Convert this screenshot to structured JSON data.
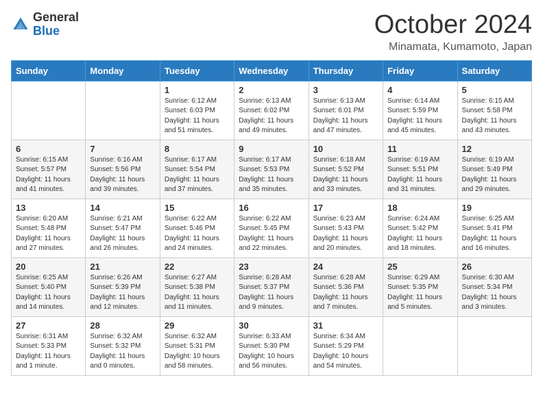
{
  "header": {
    "logo_general": "General",
    "logo_blue": "Blue",
    "title": "October 2024",
    "subtitle": "Minamata, Kumamoto, Japan"
  },
  "weekdays": [
    "Sunday",
    "Monday",
    "Tuesday",
    "Wednesday",
    "Thursday",
    "Friday",
    "Saturday"
  ],
  "weeks": [
    [
      {
        "day": "",
        "info": ""
      },
      {
        "day": "",
        "info": ""
      },
      {
        "day": "1",
        "info": "Sunrise: 6:12 AM\nSunset: 6:03 PM\nDaylight: 11 hours and 51 minutes."
      },
      {
        "day": "2",
        "info": "Sunrise: 6:13 AM\nSunset: 6:02 PM\nDaylight: 11 hours and 49 minutes."
      },
      {
        "day": "3",
        "info": "Sunrise: 6:13 AM\nSunset: 6:01 PM\nDaylight: 11 hours and 47 minutes."
      },
      {
        "day": "4",
        "info": "Sunrise: 6:14 AM\nSunset: 5:59 PM\nDaylight: 11 hours and 45 minutes."
      },
      {
        "day": "5",
        "info": "Sunrise: 6:15 AM\nSunset: 5:58 PM\nDaylight: 11 hours and 43 minutes."
      }
    ],
    [
      {
        "day": "6",
        "info": "Sunrise: 6:15 AM\nSunset: 5:57 PM\nDaylight: 11 hours and 41 minutes."
      },
      {
        "day": "7",
        "info": "Sunrise: 6:16 AM\nSunset: 5:56 PM\nDaylight: 11 hours and 39 minutes."
      },
      {
        "day": "8",
        "info": "Sunrise: 6:17 AM\nSunset: 5:54 PM\nDaylight: 11 hours and 37 minutes."
      },
      {
        "day": "9",
        "info": "Sunrise: 6:17 AM\nSunset: 5:53 PM\nDaylight: 11 hours and 35 minutes."
      },
      {
        "day": "10",
        "info": "Sunrise: 6:18 AM\nSunset: 5:52 PM\nDaylight: 11 hours and 33 minutes."
      },
      {
        "day": "11",
        "info": "Sunrise: 6:19 AM\nSunset: 5:51 PM\nDaylight: 11 hours and 31 minutes."
      },
      {
        "day": "12",
        "info": "Sunrise: 6:19 AM\nSunset: 5:49 PM\nDaylight: 11 hours and 29 minutes."
      }
    ],
    [
      {
        "day": "13",
        "info": "Sunrise: 6:20 AM\nSunset: 5:48 PM\nDaylight: 11 hours and 27 minutes."
      },
      {
        "day": "14",
        "info": "Sunrise: 6:21 AM\nSunset: 5:47 PM\nDaylight: 11 hours and 26 minutes."
      },
      {
        "day": "15",
        "info": "Sunrise: 6:22 AM\nSunset: 5:46 PM\nDaylight: 11 hours and 24 minutes."
      },
      {
        "day": "16",
        "info": "Sunrise: 6:22 AM\nSunset: 5:45 PM\nDaylight: 11 hours and 22 minutes."
      },
      {
        "day": "17",
        "info": "Sunrise: 6:23 AM\nSunset: 5:43 PM\nDaylight: 11 hours and 20 minutes."
      },
      {
        "day": "18",
        "info": "Sunrise: 6:24 AM\nSunset: 5:42 PM\nDaylight: 11 hours and 18 minutes."
      },
      {
        "day": "19",
        "info": "Sunrise: 6:25 AM\nSunset: 5:41 PM\nDaylight: 11 hours and 16 minutes."
      }
    ],
    [
      {
        "day": "20",
        "info": "Sunrise: 6:25 AM\nSunset: 5:40 PM\nDaylight: 11 hours and 14 minutes."
      },
      {
        "day": "21",
        "info": "Sunrise: 6:26 AM\nSunset: 5:39 PM\nDaylight: 11 hours and 12 minutes."
      },
      {
        "day": "22",
        "info": "Sunrise: 6:27 AM\nSunset: 5:38 PM\nDaylight: 11 hours and 11 minutes."
      },
      {
        "day": "23",
        "info": "Sunrise: 6:28 AM\nSunset: 5:37 PM\nDaylight: 11 hours and 9 minutes."
      },
      {
        "day": "24",
        "info": "Sunrise: 6:28 AM\nSunset: 5:36 PM\nDaylight: 11 hours and 7 minutes."
      },
      {
        "day": "25",
        "info": "Sunrise: 6:29 AM\nSunset: 5:35 PM\nDaylight: 11 hours and 5 minutes."
      },
      {
        "day": "26",
        "info": "Sunrise: 6:30 AM\nSunset: 5:34 PM\nDaylight: 11 hours and 3 minutes."
      }
    ],
    [
      {
        "day": "27",
        "info": "Sunrise: 6:31 AM\nSunset: 5:33 PM\nDaylight: 11 hours and 1 minute."
      },
      {
        "day": "28",
        "info": "Sunrise: 6:32 AM\nSunset: 5:32 PM\nDaylight: 11 hours and 0 minutes."
      },
      {
        "day": "29",
        "info": "Sunrise: 6:32 AM\nSunset: 5:31 PM\nDaylight: 10 hours and 58 minutes."
      },
      {
        "day": "30",
        "info": "Sunrise: 6:33 AM\nSunset: 5:30 PM\nDaylight: 10 hours and 56 minutes."
      },
      {
        "day": "31",
        "info": "Sunrise: 6:34 AM\nSunset: 5:29 PM\nDaylight: 10 hours and 54 minutes."
      },
      {
        "day": "",
        "info": ""
      },
      {
        "day": "",
        "info": ""
      }
    ]
  ]
}
